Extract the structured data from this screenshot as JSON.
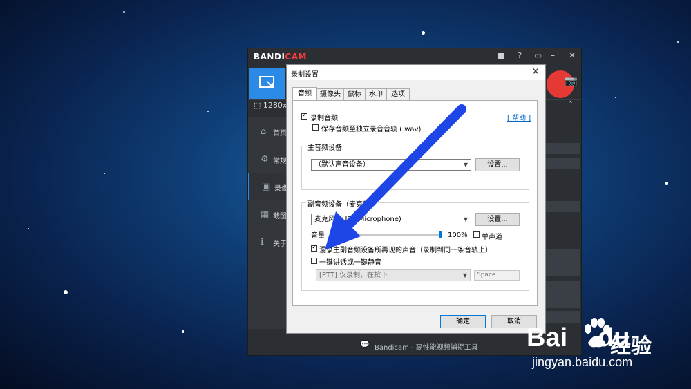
{
  "bandicam": {
    "logo_a": "BANDI",
    "logo_b": "CAM",
    "resolution": "1280x",
    "sidebar": [
      {
        "icon": "home-icon",
        "glyph": "⌂",
        "label": "首页"
      },
      {
        "icon": "gear-icon",
        "glyph": "⚙",
        "label": "常规"
      },
      {
        "icon": "video-icon",
        "glyph": "▣",
        "label": "录像"
      },
      {
        "icon": "image-icon",
        "glyph": "▦",
        "label": "截图"
      },
      {
        "icon": "info-icon",
        "glyph": "ℹ",
        "label": "关于"
      }
    ],
    "footer": "Bandicam - 高性能视频捕捉工具",
    "record_color": "#e53935",
    "accent": "#2a8ae6"
  },
  "dialog": {
    "title": "录制设置",
    "tabs": [
      "音频",
      "摄像头",
      "鼠标",
      "水印",
      "选项"
    ],
    "help_link": "[ 帮助 ]",
    "record_audio_label": "录制音频",
    "record_audio_checked": true,
    "save_wav_label": "保存音频至独立录音音轨 (.wav)",
    "save_wav_checked": false,
    "main_group_title": "主音频设备",
    "main_device_value": "（默认声音设备）",
    "settings_button": "设置...",
    "sub_group_title": "副音频设备（麦克风）",
    "sub_device_value": "麦克风（USB Microphone)",
    "volume_label": "音量",
    "volume_value": "100%",
    "volume_level": 1.0,
    "mono_label": "单声道",
    "mono_checked": false,
    "mix_label": "混录主副音频设备所再现的声音（录制到同一条音轨上）",
    "mix_checked": true,
    "ptt_label": "一键讲话或一键静音",
    "ptt_checked": false,
    "ptt_mode_value": "[PTT] 仅录制，在按下",
    "ptt_key_value": "Space",
    "ok_button": "确定",
    "cancel_button": "取消"
  },
  "watermark": {
    "brand": "Bai",
    "brand_b": "du",
    "cn": "经验",
    "url": "jingyan.baidu.com"
  },
  "annotation_arrow_color": "#1e46e6"
}
